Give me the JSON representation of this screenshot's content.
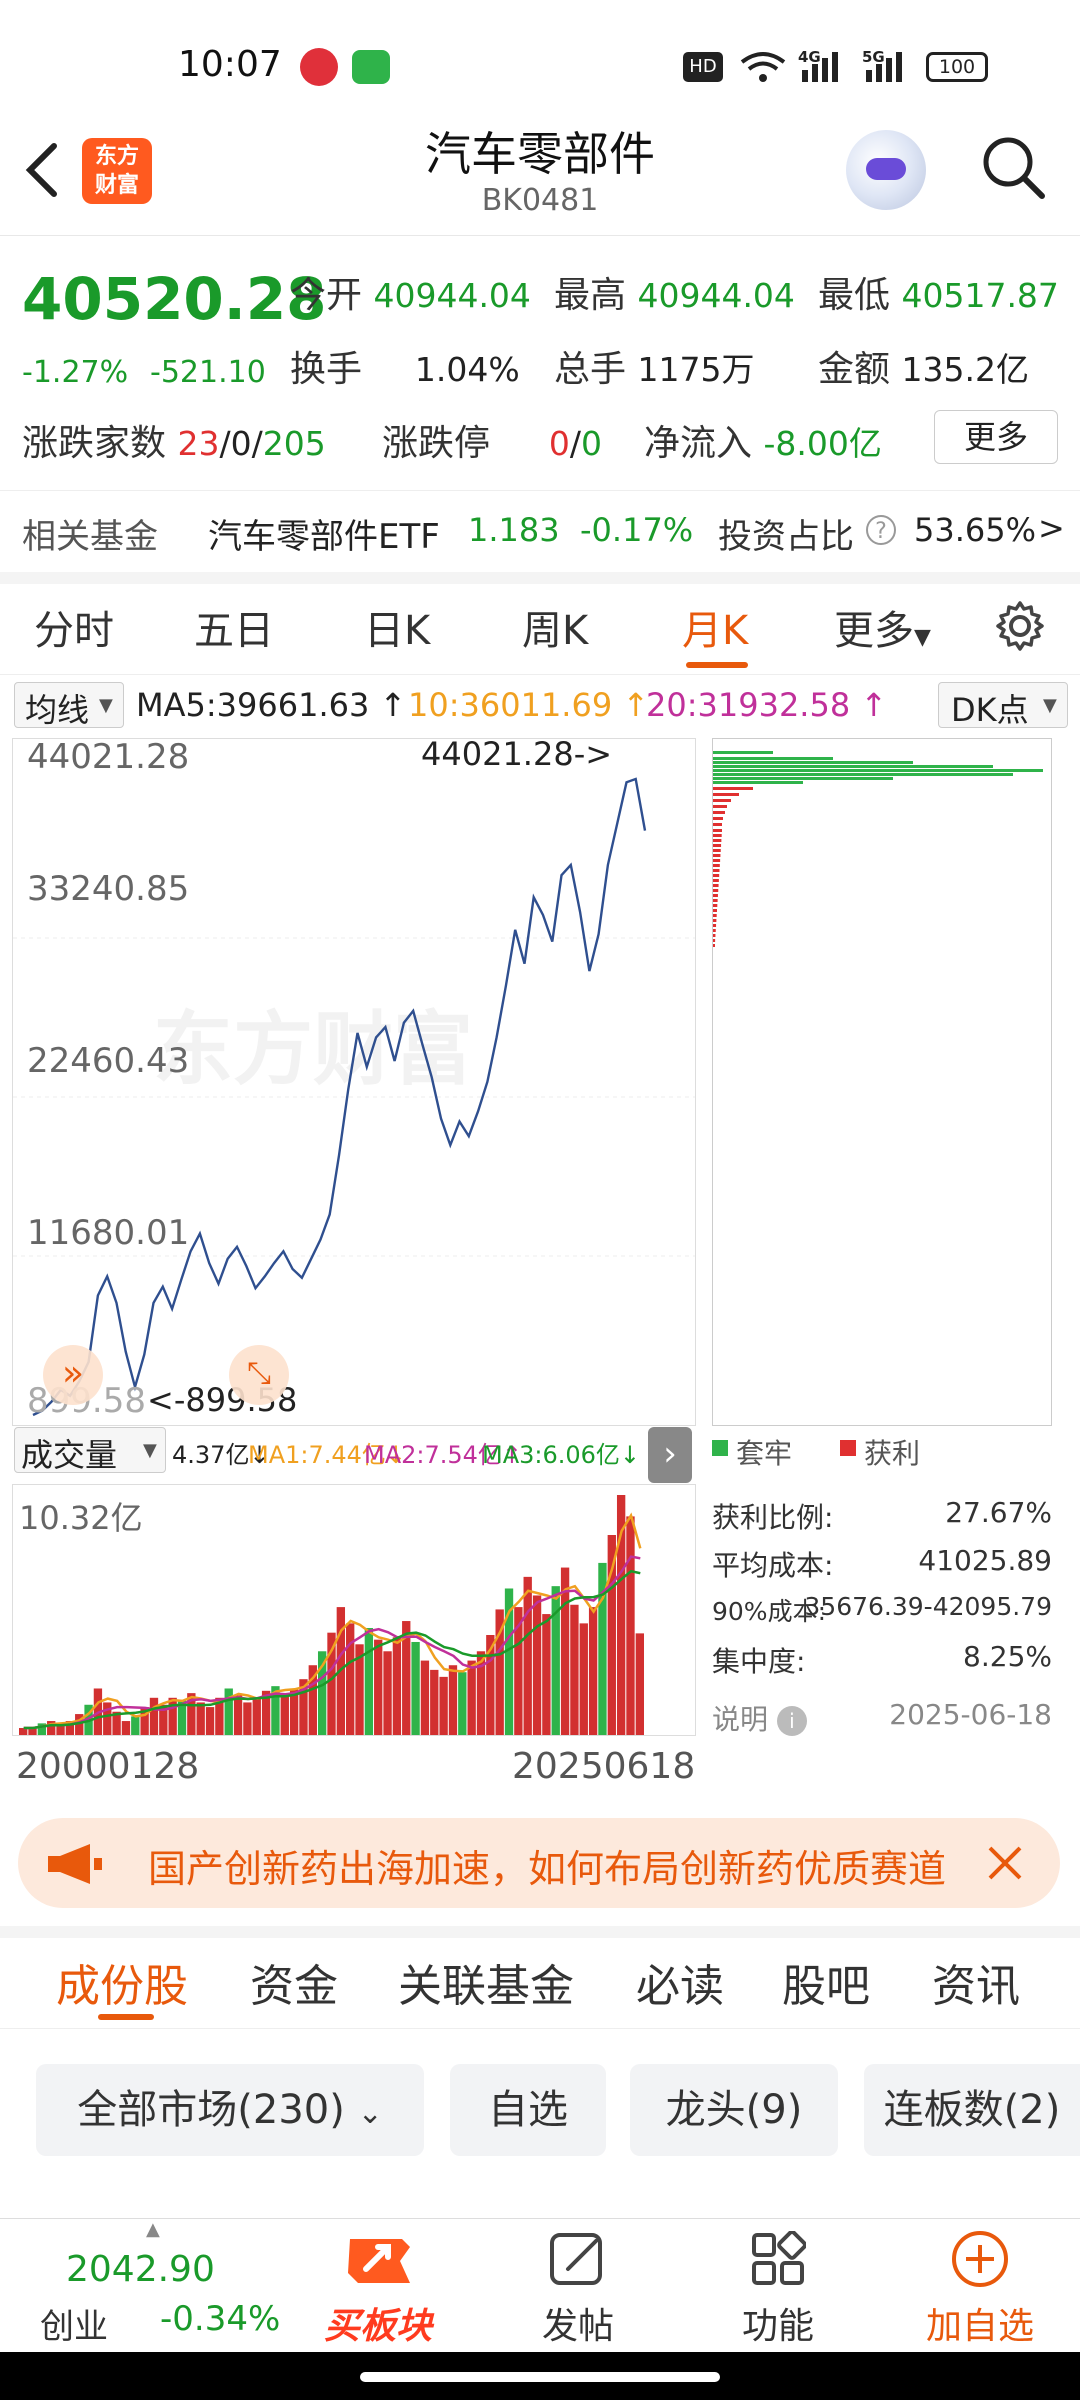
{
  "status": {
    "time": "10:07",
    "battery": "100",
    "net1": "4G",
    "net2": "5G",
    "hd": "HD"
  },
  "header": {
    "title": "汽车零部件",
    "code": "BK0481",
    "logo_line1": "东方",
    "logo_line2": "财富"
  },
  "quote": {
    "price": "40520.28",
    "change_pct": "-1.27%",
    "change_abs": "-521.10",
    "open_label": "今开",
    "open": "40944.04",
    "high_label": "最高",
    "high": "40944.04",
    "low_label": "最低",
    "low": "40517.87",
    "turnover_label": "换手",
    "turnover": "1.04%",
    "volume_label": "总手",
    "volume": "1175万",
    "amount_label": "金额",
    "amount": "135.2亿",
    "updown_label": "涨跌家数",
    "up": "23",
    "flat": "0",
    "down": "205",
    "limit_label": "涨跌停",
    "limit_up": "0",
    "limit_down": "0",
    "netflow_label": "净流入",
    "netflow": "-8.00亿",
    "more_label": "更多"
  },
  "fund": {
    "label": "相关基金",
    "name": "汽车零部件ETF",
    "price": "1.183",
    "pct": "-0.17%",
    "ratio_label": "投资占比",
    "ratio": "53.65%",
    "arrow": ">"
  },
  "chart_tabs": [
    "分时",
    "五日",
    "日K",
    "周K",
    "月K",
    "更多"
  ],
  "ma": {
    "selector": "均线",
    "ma5": "MA5:39661.63",
    "ma10": "10:36011.69",
    "ma20": "20:31932.58",
    "dk": "DK点"
  },
  "colors": {
    "accent": "#e8590c",
    "up": "#e03030",
    "down": "#1a9a2a",
    "line": "#2f4f8f",
    "ma10": "#f0a020",
    "ma20": "#c0309a"
  },
  "chart_data": {
    "type": "line",
    "y_ticks": [
      "44021.28",
      "33240.85",
      "22460.43",
      "11680.01",
      "899.58"
    ],
    "ylim": [
      899.58,
      44021.28
    ],
    "max_label": "44021.28->",
    "min_label": "<-899.58",
    "x_start": "20000128",
    "x_end": "20250618",
    "values": [
      900,
      1200,
      1800,
      2600,
      2200,
      3200,
      4500,
      9000,
      10300,
      8500,
      5200,
      2800,
      5000,
      8500,
      9600,
      8100,
      10100,
      12000,
      13200,
      11200,
      9800,
      11500,
      12300,
      11000,
      9500,
      10300,
      11200,
      12000,
      10800,
      10200,
      11500,
      12800,
      14500,
      18500,
      23000,
      26800,
      24500,
      26500,
      27200,
      24900,
      27500,
      28300,
      26000,
      23800,
      21000,
      19200,
      20800,
      19800,
      21500,
      23500,
      26500,
      30000,
      33800,
      31500,
      36000,
      34800,
      33000,
      37500,
      38200,
      35000,
      31000,
      33500,
      38200,
      41000,
      43800,
      44021,
      40520
    ]
  },
  "volume": {
    "selector": "成交量",
    "val": "4.37亿",
    "ma1": "MA1:7.44亿",
    "ma2": "MA2:7.54亿",
    "ma3": "MA3:6.06亿",
    "max_label": "10.32亿",
    "bars": [
      0.3,
      0.3,
      0.5,
      0.6,
      0.4,
      0.6,
      0.9,
      1.3,
      2.0,
      1.4,
      1.0,
      0.6,
      0.8,
      1.2,
      1.6,
      1.3,
      1.6,
      1.5,
      1.8,
      1.4,
      1.2,
      1.6,
      2.0,
      1.7,
      1.4,
      1.6,
      1.9,
      2.1,
      1.8,
      2.0,
      2.4,
      3.0,
      3.6,
      4.4,
      5.5,
      4.8,
      3.9,
      4.6,
      4.1,
      3.6,
      4.2,
      4.9,
      4.0,
      3.2,
      2.8,
      2.5,
      3.0,
      2.7,
      3.2,
      3.6,
      4.3,
      5.4,
      6.3,
      5.5,
      6.8,
      6.0,
      5.2,
      6.4,
      7.2,
      5.6,
      4.8,
      5.5,
      7.4,
      8.6,
      10.32,
      9.4,
      4.37
    ]
  },
  "dk": {
    "trapped_label": "套牢",
    "profit_label": "获利",
    "profit_ratio_label": "获利比例:",
    "profit_ratio": "27.67%",
    "avg_cost_label": "平均成本:",
    "avg_cost": "41025.89",
    "cost90_label": "90%成本:",
    "cost90": "35676.39-42095.79",
    "conc_label": "集中度:",
    "conc": "8.25%",
    "note_label": "说明",
    "date": "2025-06-18"
  },
  "ticker": {
    "text": "国产创新药出海加速，如何布局创新药优质赛道"
  },
  "bottom_tabs": [
    "成份股",
    "资金",
    "关联基金",
    "必读",
    "股吧",
    "资讯"
  ],
  "filters": [
    "全部市场(230)",
    "自选",
    "龙头(9)",
    "连板数(2)"
  ],
  "bottom_bar": {
    "index_value": "2042.90",
    "index_name": "创业",
    "index_pct": "-0.34%",
    "buy_label": "买板块",
    "post_label": "发帖",
    "func_label": "功能",
    "add_label": "加自选"
  }
}
